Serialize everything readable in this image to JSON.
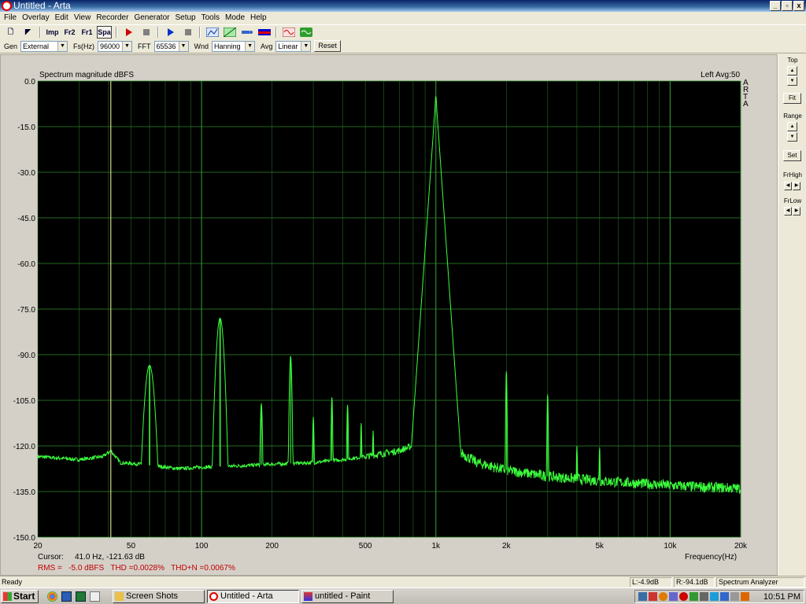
{
  "window": {
    "title": "Untitled - Arta",
    "controls": [
      "_",
      "▫",
      "x"
    ]
  },
  "menu": [
    "File",
    "Overlay",
    "Edit",
    "View",
    "Recorder",
    "Generator",
    "Setup",
    "Tools",
    "Mode",
    "Help"
  ],
  "toolbar": {
    "buttons": [
      {
        "name": "open-icon",
        "glyph": "🗋"
      },
      {
        "name": "pointer-icon",
        "glyph": "◤"
      },
      {
        "name": "imp-mode-button",
        "glyph": "Imp"
      },
      {
        "name": "fr2-mode-button",
        "glyph": "Fr2"
      },
      {
        "name": "fr1-mode-button",
        "glyph": "Fr1"
      },
      {
        "name": "spa-mode-button",
        "glyph": "Spa"
      }
    ]
  },
  "setup": {
    "gen_label": "Gen",
    "gen_value": "External",
    "fs_label": "Fs(Hz)",
    "fs_value": "96000",
    "fft_label": "FFT",
    "fft_value": "65536",
    "wnd_label": "Wnd",
    "wnd_value": "Hanning",
    "avg_label": "Avg",
    "avg_value": "Linear",
    "reset_label": "Reset"
  },
  "side": {
    "top_label": "Top",
    "fit_label": "Fit",
    "range_label": "Range",
    "set_label": "Set",
    "frhigh_label": "FrHigh",
    "frlow_label": "FrLow"
  },
  "chart_data": {
    "type": "line",
    "title": "Spectrum magnitude dBFS",
    "info_right": "Left  Avg:50",
    "brand_vertical": "ARTA",
    "xlabel": "Frequency(Hz)",
    "ylabel": "",
    "x_scale": "log",
    "xlim": [
      20,
      20000
    ],
    "ylim": [
      -150,
      0
    ],
    "y_ticks": [
      "0.0",
      "-15.0",
      "-30.0",
      "-45.0",
      "-60.0",
      "-75.0",
      "-90.0",
      "-105.0",
      "-120.0",
      "-135.0",
      "-150.0"
    ],
    "x_ticks": [
      {
        "v": 20,
        "label": "20"
      },
      {
        "v": 50,
        "label": "50"
      },
      {
        "v": 100,
        "label": "100"
      },
      {
        "v": 200,
        "label": "200"
      },
      {
        "v": 500,
        "label": "500"
      },
      {
        "v": 1000,
        "label": "1k"
      },
      {
        "v": 2000,
        "label": "2k"
      },
      {
        "v": 5000,
        "label": "5k"
      },
      {
        "v": 10000,
        "label": "10k"
      },
      {
        "v": 20000,
        "label": "20k"
      }
    ],
    "grid": true,
    "background": "#000000",
    "grid_color": "#2e8b2e",
    "trace_color": "#3cff3c",
    "cursor_color": "#ffff99",
    "cursor_x": 41.0,
    "noise_floor": [
      [
        20,
        -123.5
      ],
      [
        30,
        -124.5
      ],
      [
        38,
        -123.5
      ],
      [
        41,
        -121.6
      ],
      [
        45,
        -125.5
      ],
      [
        55,
        -126
      ],
      [
        80,
        -127.5
      ],
      [
        100,
        -127
      ],
      [
        150,
        -126.5
      ],
      [
        200,
        -126
      ],
      [
        300,
        -125.5
      ],
      [
        400,
        -124.5
      ],
      [
        500,
        -123.5
      ],
      [
        600,
        -122.5
      ],
      [
        700,
        -121.5
      ],
      [
        800,
        -120
      ],
      [
        900,
        -116.5
      ],
      [
        950,
        -111
      ],
      [
        1000,
        -5
      ],
      [
        1050,
        -111
      ],
      [
        1100,
        -118
      ],
      [
        1200,
        -121
      ],
      [
        1500,
        -125.5
      ],
      [
        2000,
        -128
      ],
      [
        3000,
        -130
      ],
      [
        5000,
        -131.5
      ],
      [
        10000,
        -133
      ],
      [
        20000,
        -134
      ]
    ],
    "peaks": [
      {
        "f": 60,
        "db": -93.5,
        "w": 4.5
      },
      {
        "f": 120,
        "db": -78,
        "w": 3.5
      },
      {
        "f": 180,
        "db": -106,
        "w": 1.6
      },
      {
        "f": 240,
        "db": -90.5,
        "w": 1.8
      },
      {
        "f": 300,
        "db": -110.5,
        "w": 1.2
      },
      {
        "f": 360,
        "db": -104,
        "w": 1.2
      },
      {
        "f": 420,
        "db": -106.5,
        "w": 1.2
      },
      {
        "f": 480,
        "db": -112.5,
        "w": 1
      },
      {
        "f": 540,
        "db": -115,
        "w": 1
      },
      {
        "f": 1000,
        "db": -5,
        "w": 2
      },
      {
        "f": 2000,
        "db": -95.5,
        "w": 1
      },
      {
        "f": 3000,
        "db": -103,
        "w": 1
      },
      {
        "f": 4000,
        "db": -120,
        "w": 1
      },
      {
        "f": 5000,
        "db": -120.5,
        "w": 1
      }
    ]
  },
  "readout": {
    "cursor_label": "Cursor:",
    "cursor_value": "41.0 Hz, -121.63 dB",
    "stats": "RMS =   -5.0 dBFS   THD =0.0028%   THD+N =0.0067%"
  },
  "status": {
    "ready": "Ready",
    "left": "L:-4.9dB",
    "right": "R:-94.1dB",
    "mode": "Spectrum Analyzer"
  },
  "taskbar": {
    "start": "Start",
    "tasks": [
      "Screen Shots",
      "Untitled - Arta",
      "untitled - Paint"
    ],
    "clock": "10:51 PM"
  }
}
